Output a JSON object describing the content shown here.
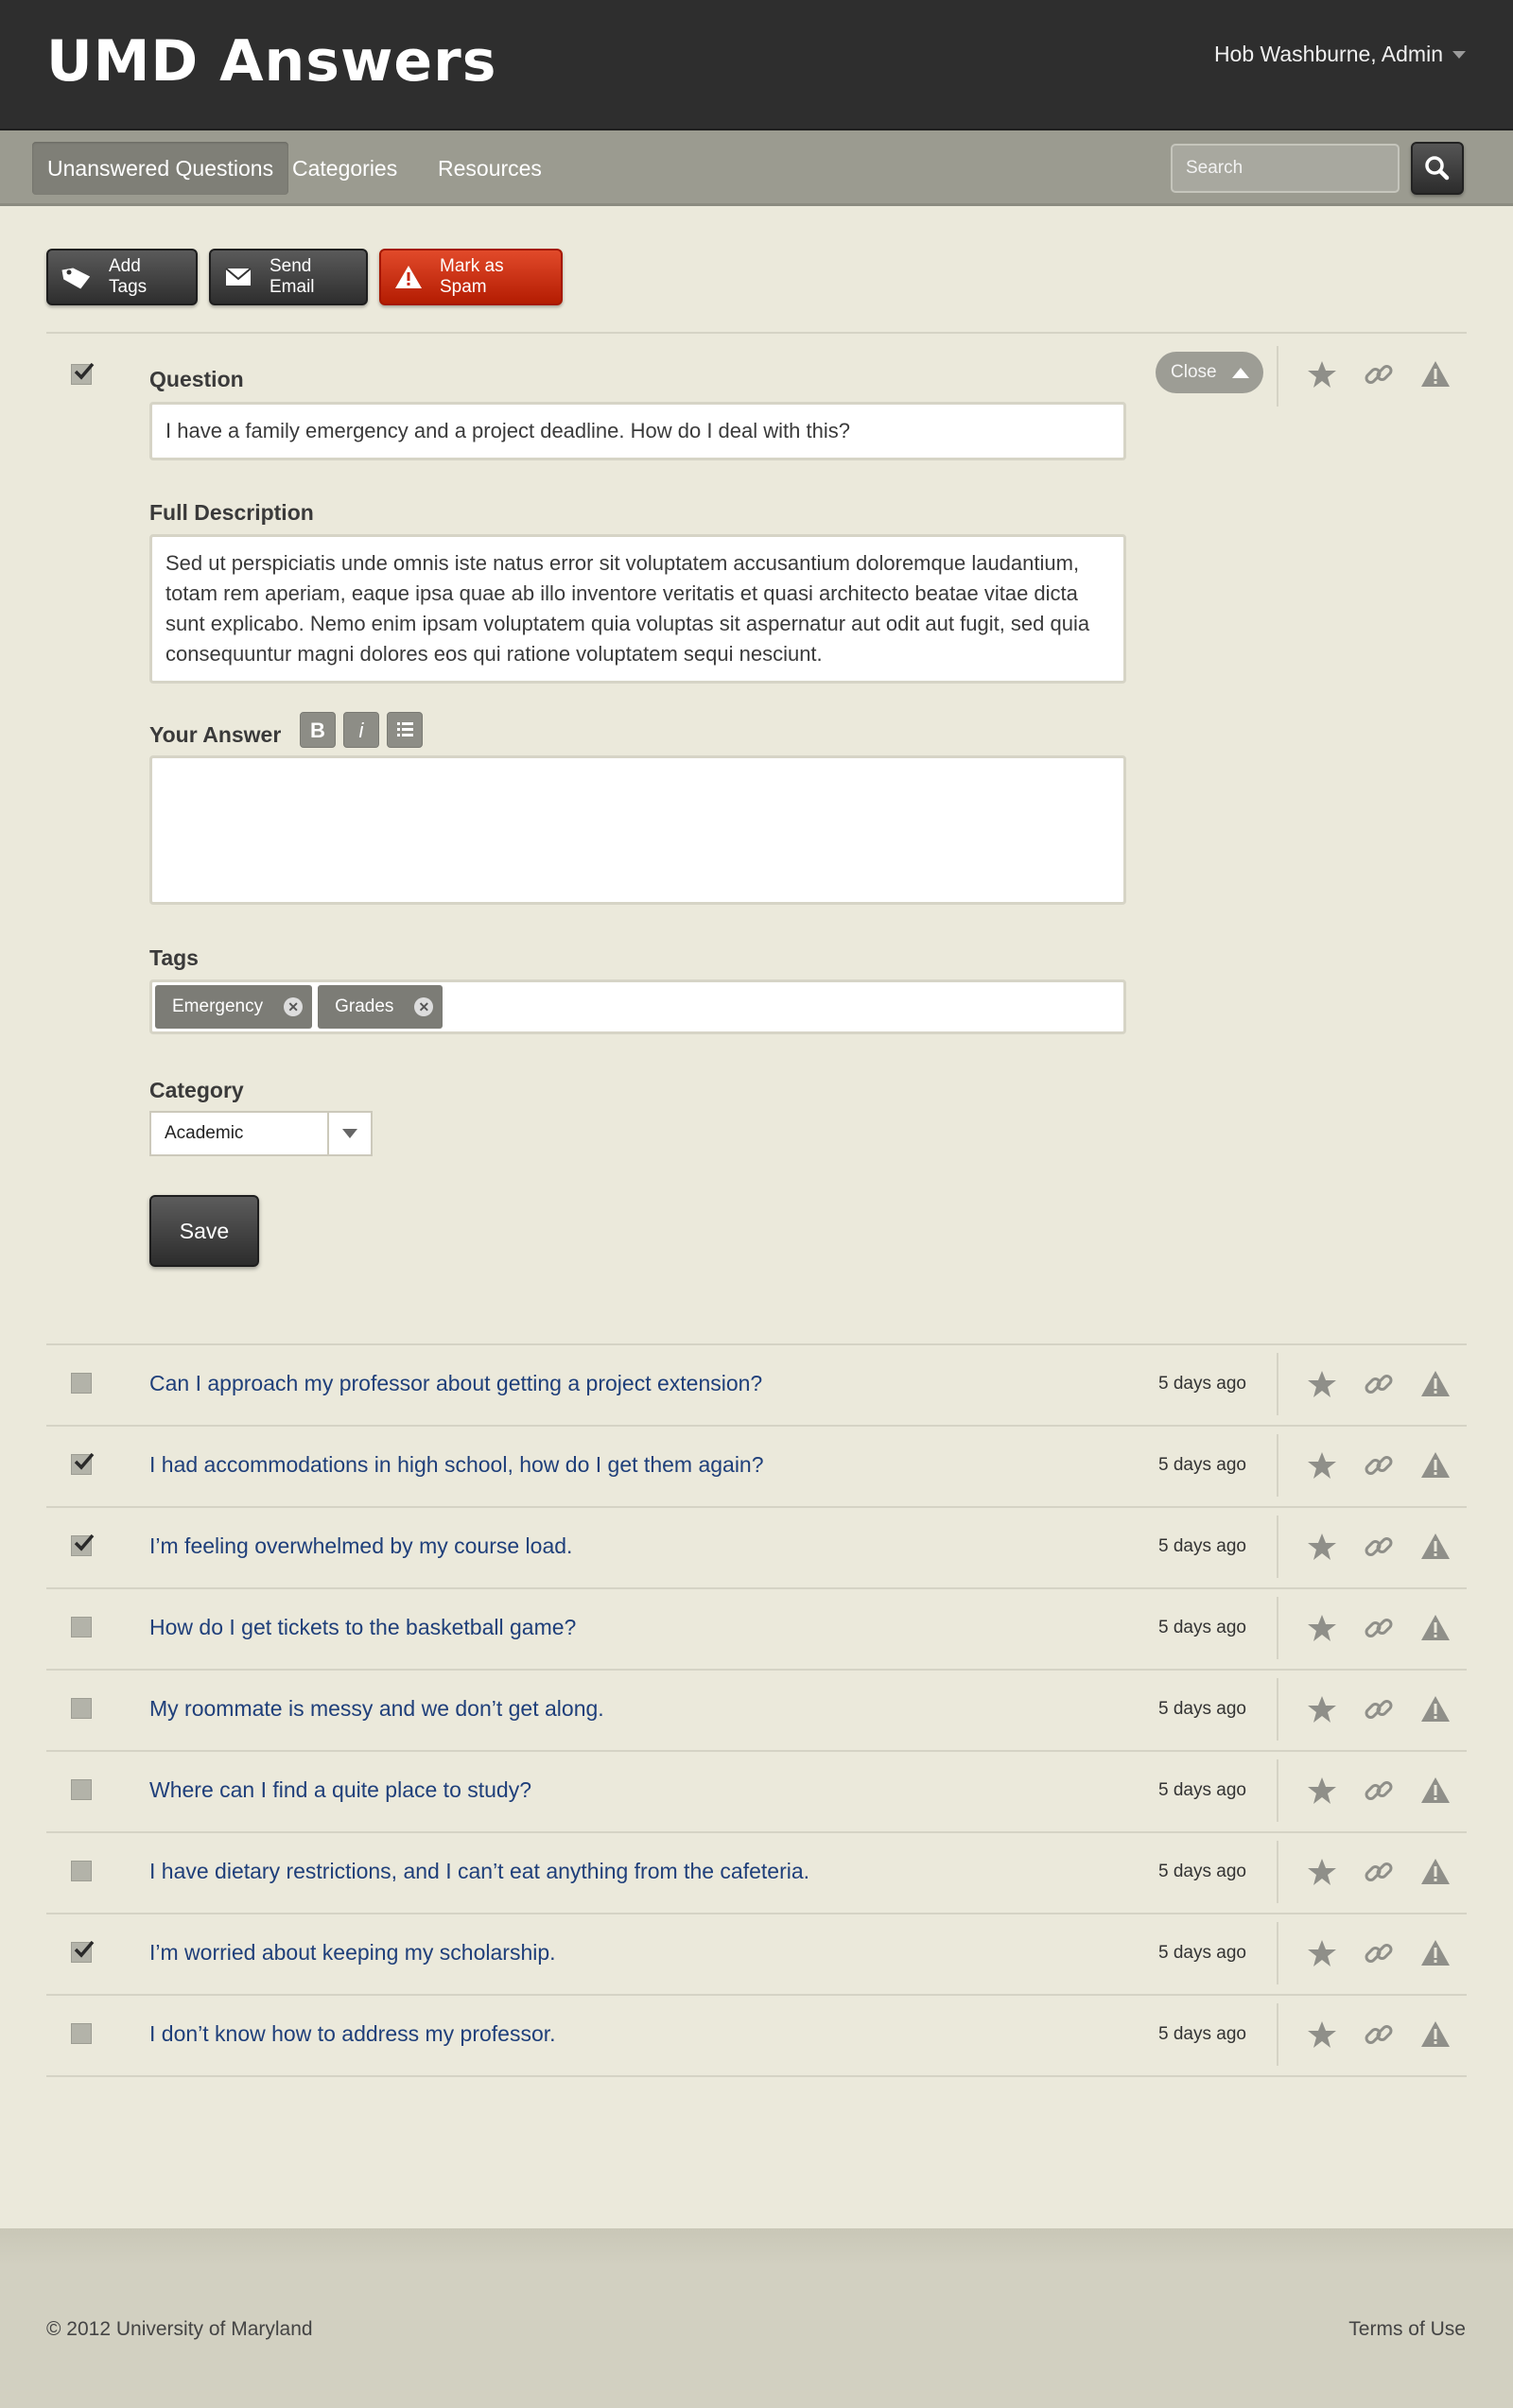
{
  "header": {
    "logo": "UMD Answers",
    "user": "Hob Washburne, Admin"
  },
  "nav": {
    "tabs": [
      {
        "label": "Unanswered Questions",
        "active": true
      },
      {
        "label": "Categories",
        "active": false
      },
      {
        "label": "Resources",
        "active": false
      }
    ],
    "search_placeholder": "Search"
  },
  "actions": {
    "add_tags": "Add Tags",
    "send_email": "Send Email",
    "mark_spam": "Mark as Spam"
  },
  "expanded": {
    "checked": true,
    "close_label": "Close",
    "question_label": "Question",
    "question_value": "I have a family emergency and a project deadline. How do I deal with this?",
    "description_label": "Full Description",
    "description_value": "Sed ut perspiciatis unde omnis iste natus error sit voluptatem accusantium doloremque laudantium, totam rem aperiam, eaque ipsa quae ab illo inventore veritatis et quasi architecto beatae vitae dicta sunt explicabo. Nemo enim ipsam voluptatem quia voluptas sit aspernatur aut odit aut fugit, sed quia consequuntur magni dolores eos qui ratione voluptatem sequi nesciunt.",
    "answer_label": "Your Answer",
    "answer_value": "",
    "format_buttons": [
      "B",
      "i"
    ],
    "tags_label": "Tags",
    "tags": [
      "Emergency",
      "Grades"
    ],
    "category_label": "Category",
    "category_value": "Academic",
    "save_label": "Save"
  },
  "questions": [
    {
      "text": "Can I approach my professor about getting a project extension?",
      "time": "5 days ago",
      "checked": false
    },
    {
      "text": "I had accommodations in high school, how do I get them again?",
      "time": "5 days ago",
      "checked": true
    },
    {
      "text": "I’m feeling overwhelmed by my course load.",
      "time": "5 days ago",
      "checked": true
    },
    {
      "text": "How do I get tickets to the basketball game?",
      "time": "5 days ago",
      "checked": false
    },
    {
      "text": "My roommate is messy and we don’t get along.",
      "time": "5 days ago",
      "checked": false
    },
    {
      "text": "Where can I find a quite place to study?",
      "time": "5 days ago",
      "checked": false
    },
    {
      "text": "I have dietary restrictions, and I can’t eat anything from the cafeteria.",
      "time": "5 days ago",
      "checked": false
    },
    {
      "text": "I’m worried about keeping my scholarship.",
      "time": "5 days ago",
      "checked": true
    },
    {
      "text": "I don’t know how to address my professor.",
      "time": "5 days ago",
      "checked": false
    }
  ],
  "icons": {
    "row": [
      "star-icon",
      "link-icon",
      "warning-icon"
    ],
    "icon_color": "#8f8f89"
  },
  "colors": {
    "header_bg": "#2e2e2e",
    "nav_bg": "#9b9b90",
    "page_bg": "#ebe9db",
    "link": "#1f3f7a",
    "spam": "#c9240a"
  },
  "footer": {
    "copyright": "© 2012 University of Maryland",
    "terms": "Terms of Use"
  }
}
